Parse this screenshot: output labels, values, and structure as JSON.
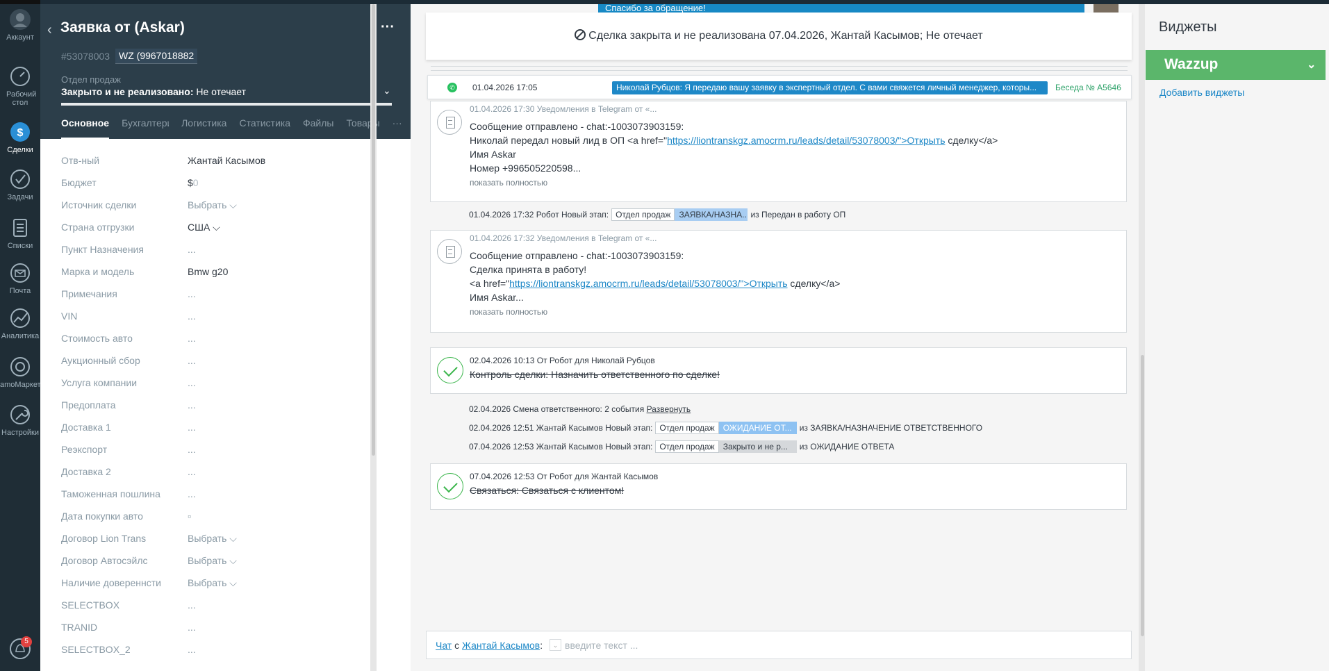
{
  "nav": {
    "items": [
      {
        "label": "Аккаунт",
        "icon": "avatar-icon"
      },
      {
        "label": "Рабочий стол",
        "icon": "dashboard-icon"
      },
      {
        "label": "Сделки",
        "icon": "deals-icon"
      },
      {
        "label": "Задачи",
        "icon": "tasks-icon"
      },
      {
        "label": "Списки",
        "icon": "lists-icon"
      },
      {
        "label": "Почта",
        "icon": "mail-icon"
      },
      {
        "label": "Аналитика",
        "icon": "analytics-icon"
      },
      {
        "label": "amoМаркет",
        "icon": "market-icon"
      },
      {
        "label": "Настройки",
        "icon": "settings-icon"
      }
    ],
    "notifications_count": "5"
  },
  "lead": {
    "title": "Заявка от (Askar)",
    "id": "#53078003",
    "tag": "WZ (9967018882",
    "pipeline": "Отдел продаж",
    "status_label": "Закрыто и не реализовано:",
    "status_reason": "Не отечает",
    "tabs": [
      "Основное",
      "Бухгалтерия",
      "Логистика",
      "Статистика",
      "Файлы",
      "Товары"
    ],
    "more_tabs": "···",
    "fields": [
      {
        "label": "Отв-ный",
        "value": "Жантай Касымов"
      },
      {
        "label": "Бюджет",
        "value": "$",
        "value_dim": "0"
      },
      {
        "label": "Источник сделки",
        "value": "Выбрать ⌵"
      },
      {
        "label": "Страна отгрузки",
        "value": "США ⌵"
      },
      {
        "label": "Пункт Назначения",
        "value": "..."
      },
      {
        "label": "Марка и модель",
        "value": "Bmw g20"
      },
      {
        "label": "Примечания",
        "value": "..."
      },
      {
        "label": "VIN",
        "value": "..."
      },
      {
        "label": "Стоимость авто",
        "value": "..."
      },
      {
        "label": "Аукционный сбор",
        "value": "..."
      },
      {
        "label": "Услуга компании",
        "value": "..."
      },
      {
        "label": "Предоплата",
        "value": "..."
      },
      {
        "label": "Доставка 1",
        "value": "..."
      },
      {
        "label": "Реэкспорт",
        "value": "..."
      },
      {
        "label": "Доставка 2",
        "value": "..."
      },
      {
        "label": "Таможенная пошлина",
        "value": "..."
      },
      {
        "label": "Дата покупки авто",
        "value": "▫"
      },
      {
        "label": "Договор Lion Trans",
        "value": "Выбрать ⌵"
      },
      {
        "label": "Договор Автосэйлс",
        "value": "Выбрать ⌵"
      },
      {
        "label": "Наличие довереннсти",
        "value": "Выбрать ⌵"
      },
      {
        "label": "SELECTBOX",
        "value": "..."
      },
      {
        "label": "TRANID",
        "value": "..."
      },
      {
        "label": "SELECTBOX_2",
        "value": "..."
      }
    ]
  },
  "feed": {
    "banner_text": "Спасибо за обращение!",
    "closed_text": "Сделка закрыта и не реализована 07.04.2026, Жантай Касымов; Не отечает",
    "pinned": {
      "date": "01.04.2026 17:05",
      "message": "Николай Рубцов: Я передаю вашу заявку в экспертный отдел. С вами свяжется личный менеджер, которы...",
      "conversation": "Беседа № A5646"
    },
    "note1": {
      "meta": "01.04.2026 17:30 Уведомления в Telegram от «...",
      "line1": "Сообщение отправлено - chat:-1003073903159:",
      "line2_pre": "Николай передал новый лид в ОП <a href=\"",
      "line2_link": "https://liontranskgz.amocrm.ru/leads/detail/53078003/\">Открыть",
      "line2_post": " сделку</a>",
      "line3": "Имя Askar",
      "line4": "Номер +996505220598...",
      "more": "показать полностью"
    },
    "event1": {
      "text": "01.04.2026 17:32 Робот Новый этап:",
      "from": "Отдел продаж",
      "to": "ЗАЯВКА/НАЗНА...",
      "tail": "из Передан в работу ОП",
      "to_color": "#a8cdf2"
    },
    "note2": {
      "meta": "01.04.2026 17:32 Уведомления в Telegram от «...",
      "line1": "Сообщение отправлено - chat:-1003073903159:",
      "line2": "Сделка принята в работу!",
      "line3_pre": "<a href=\"",
      "line3_link": "https://liontranskgz.amocrm.ru/leads/detail/53078003/\">Открыть",
      "line3_post": " сделку</a>",
      "line4": "Имя Askar...",
      "more": "показать полностью"
    },
    "task1": {
      "meta": "02.04.2026 10:13  От Робот для Николай Рубцов",
      "text": "Контроль сделки: Назначить ответственного по сделке!"
    },
    "event2": {
      "text": "02.04.2026 Смена ответственного: 2 события",
      "link": "Развернуть"
    },
    "event3": {
      "text": "02.04.2026 12:51 Жантай Касымов Новый этап:",
      "from": "Отдел продаж",
      "to": "ОЖИДАНИЕ ОТ...",
      "tail": "из ЗАЯВКА/НАЗНАЧЕНИЕ ОТВЕТСТВЕННОГО",
      "to_color": "#8ec2f2"
    },
    "event4": {
      "text": "07.04.2026 12:53 Жантай Касымов Новый этап:",
      "from": "Отдел продаж",
      "to": "Закрыто и не р...",
      "tail": "из ОЖИДАНИЕ ОТВЕТА",
      "to_color": "#d5d8db"
    },
    "task2": {
      "meta": "07.04.2026 12:53  От Робот для Жантай Касымов",
      "text": "Связаться: Связаться с клиентом!"
    },
    "chat": {
      "chat_link": "Чат",
      "with": " с ",
      "user_link": "Жантай Касымов",
      "colon": ":",
      "placeholder": "введите текст ..."
    }
  },
  "widgets": {
    "title": "Виджеты",
    "wazzup": "Wazzup",
    "add": "Добавить виджеты"
  },
  "colors": {
    "nav_bg": "#1f2d36",
    "card_head_bg": "#2c3e4a",
    "accent_blue": "#1e88c7",
    "wazzup_green": "#5bb66b",
    "task_green": "#39b54a"
  }
}
